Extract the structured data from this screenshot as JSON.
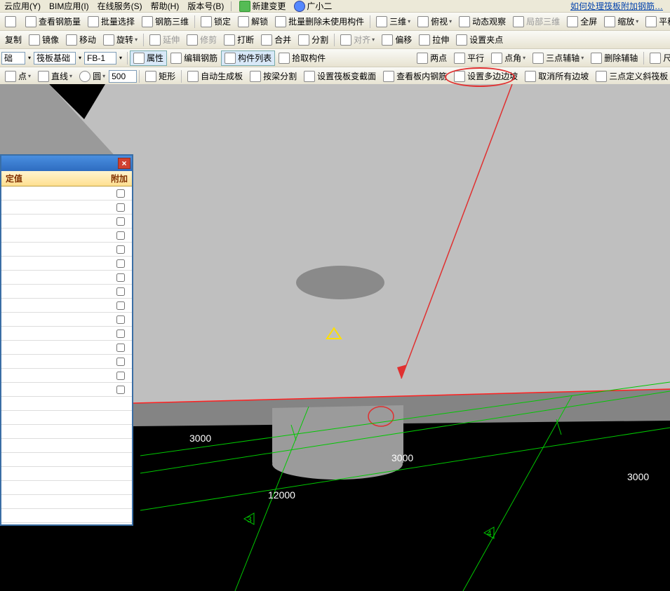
{
  "menubar": {
    "items": [
      "云应用(Y)",
      "BIM应用(I)",
      "在线服务(S)",
      "帮助(H)",
      "版本号(B)"
    ],
    "new_change": "新建变更",
    "helper": "广小二",
    "link": "如何处理筏板附加钢筋…"
  },
  "tb1": {
    "view_rebar": "查看钢筋量",
    "batch_select": "批量选择",
    "rebar_3d": "钢筋三维",
    "lock": "锁定",
    "unlock": "解锁",
    "batch_del": "批量删除未使用构件",
    "three_d": "三维",
    "top_view": "俯视",
    "dyn_view": "动态观察",
    "local_3d": "局部三维",
    "fullscreen": "全屏",
    "zoom": "缩放",
    "pan": "平移"
  },
  "tb2": {
    "copy": "复制",
    "mirror": "镜像",
    "move": "移动",
    "rotate": "旋转",
    "extend": "延伸",
    "trim": "修剪",
    "break": "打断",
    "merge": "合并",
    "split": "分割",
    "align": "对齐",
    "offset": "偏移",
    "stretch": "拉伸",
    "set_grip": "设置夹点"
  },
  "tb3": {
    "sel1": "础",
    "sel2": "筏板基础",
    "sel3": "FB-1",
    "prop": "属性",
    "edit_rebar": "编辑钢筋",
    "comp_list": "构件列表",
    "pick": "拾取构件",
    "two_pt": "两点",
    "parallel": "平行",
    "pt_angle": "点角",
    "three_aux": "三点辅轴",
    "del_aux": "删除辅轴",
    "dim": "尺寸标注"
  },
  "tb4": {
    "pt": "点",
    "line": "直线",
    "circle": "圆",
    "size": "500",
    "rect": "矩形",
    "auto_slab": "自动生成板",
    "beam_split": "按梁分割",
    "set_section": "设置筏板变截面",
    "view_slab_rebar": "查看板内钢筋",
    "set_poly_slope": "设置多边边坡",
    "cancel_slope": "取消所有边坡",
    "three_pt_slab": "三点定义斜筏板"
  },
  "panel": {
    "col1": "定值",
    "col2": "附加"
  },
  "dims": {
    "d1": "3000",
    "d2": "3000",
    "d3": "3000",
    "d4": "12000",
    "axis3": "3",
    "axis4": "4"
  }
}
